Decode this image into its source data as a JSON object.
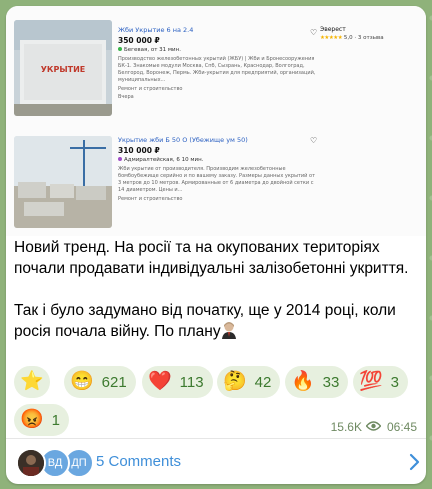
{
  "listings": [
    {
      "title": "Жби Укрытие 6 на 2.4",
      "price": "350 000 ₽",
      "location": "Бегевая, от 31 мин.",
      "description": "Производство железобетонных укрытий (ЖБУ) | Жби и Бронесооружения БК-1. Знакомые модули Москва, Спб, Сызрань, Краснодар, Волгоград, Белгород, Воронеж, Пермь. Жби-укрытия для предприятий, организаций, муниципальных...",
      "category": "Ремонт и строительство",
      "date": "Вчера",
      "photo_sign": "УКРЫТИЕ"
    },
    {
      "title": "Укрытие жби Б 50 О (Убежище ум 50)",
      "price": "310 000 ₽",
      "location": "Адмиралтейская, 6 10 мин.",
      "description": "Жби укрытие от производителя. Производим железобетонные бомбоубежище серийно и по вашему заказу. Размеры данных укрытий от 3 метров до 10 метров. Армированные от 6 диаметра до двойной сетки с 14 диаметром. Цены и...",
      "category": "Ремонт и строительство"
    }
  ],
  "seller": {
    "name": "Эверест",
    "rating": "5,0",
    "reviews": "3 отзыва"
  },
  "message": {
    "paragraph1": "Новий тренд. На росії та на окупованих територіях почали продавати індивідуальні залізобетонні укриття.",
    "paragraph2": "Так і було задумано від початку, ще у 2014 році, коли росія почала війну. По плану"
  },
  "reactions": [
    {
      "emoji": "⭐",
      "count": ""
    },
    {
      "emoji": "😁",
      "count": "621"
    },
    {
      "emoji": "❤️",
      "count": "113"
    },
    {
      "emoji": "🤔",
      "count": "42"
    },
    {
      "emoji": "🔥",
      "count": "33"
    },
    {
      "emoji": "💯",
      "count": "3"
    },
    {
      "emoji": "😡",
      "count": "1"
    }
  ],
  "views": "15.6K",
  "time": "06:45",
  "comments": {
    "label": "5 Comments",
    "avatars": [
      "ВД",
      "ДП"
    ]
  },
  "colors": {
    "accent": "#3f8fd9",
    "reaction_bg": "#e7f0df",
    "reaction_text": "#3d7a2f"
  }
}
